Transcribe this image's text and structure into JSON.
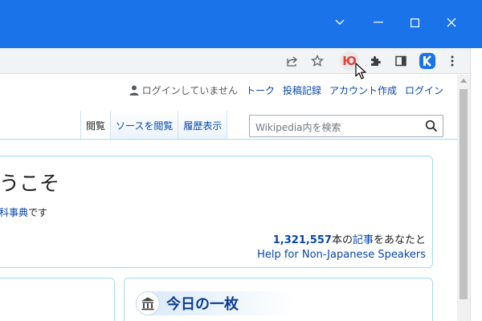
{
  "browser": {
    "extensions": {
      "yu_label": "Ю"
    }
  },
  "personal": {
    "not_logged_in": "ログインしていません",
    "talk": "トーク",
    "contributions": "投稿記録",
    "create_account": "アカウント作成",
    "login": "ログイン"
  },
  "tabs": [
    "閲覧",
    "ソースを閲覧",
    "履歴表示"
  ],
  "search": {
    "placeholder": "Wikipedia内を検索"
  },
  "welcome": {
    "title_fragment": "うこそ",
    "subtitle_link": "科事典",
    "subtitle_rest": "です",
    "article_count": "1,321,557",
    "count_unit": "本の",
    "count_link": "記事",
    "count_rest": "をあなたと",
    "help_link": "Help for Non-Japanese Speakers"
  },
  "featured_picture": {
    "title": "今日の一枚"
  },
  "colors": {
    "titlebar": "#1a73e8",
    "link": "#0645ad",
    "border": "#a7d7f9"
  }
}
